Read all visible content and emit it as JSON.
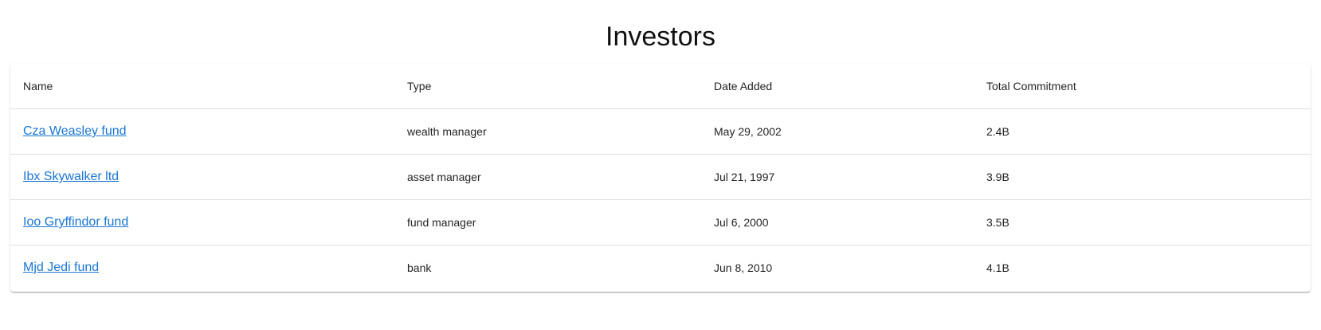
{
  "page": {
    "title": "Investors"
  },
  "table": {
    "headers": {
      "name": "Name",
      "type": "Type",
      "date_added": "Date Added",
      "total_commitment": "Total Commitment"
    },
    "rows": [
      {
        "name": "Cza Weasley fund",
        "type": "wealth manager",
        "date_added": "May 29, 2002",
        "total_commitment": "2.4B"
      },
      {
        "name": "Ibx Skywalker ltd",
        "type": "asset manager",
        "date_added": "Jul 21, 1997",
        "total_commitment": "3.9B"
      },
      {
        "name": "Ioo Gryffindor fund",
        "type": "fund manager",
        "date_added": "Jul 6, 2000",
        "total_commitment": "3.5B"
      },
      {
        "name": "Mjd Jedi fund",
        "type": "bank",
        "date_added": "Jun 8, 2010",
        "total_commitment": "4.1B"
      }
    ]
  },
  "colors": {
    "link": "#1976d2",
    "divider": "#e0e0e0"
  }
}
